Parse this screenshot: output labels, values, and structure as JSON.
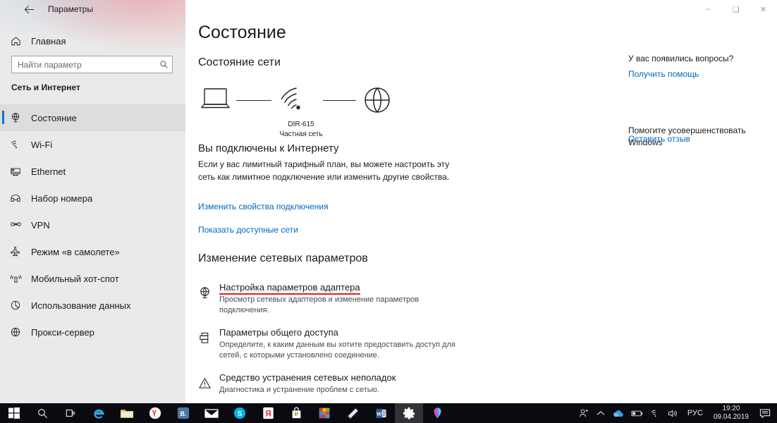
{
  "window": {
    "title": "Параметры",
    "back_icon": "back-arrow-icon",
    "minimize_label": "–",
    "maximize_label": "❑",
    "close_label": "✕"
  },
  "sidebar": {
    "home": {
      "label": "Главная",
      "icon": "home-icon"
    },
    "search": {
      "value": "",
      "placeholder": "Найти параметр",
      "icon": "search-icon"
    },
    "group_title": "Сеть и Интернет",
    "items": [
      {
        "label": "Состояние",
        "icon": "network-status-icon",
        "selected": true
      },
      {
        "label": "Wi-Fi",
        "icon": "wifi-icon",
        "selected": false
      },
      {
        "label": "Ethernet",
        "icon": "ethernet-icon",
        "selected": false
      },
      {
        "label": "Набор номера",
        "icon": "dialup-icon",
        "selected": false
      },
      {
        "label": "VPN",
        "icon": "vpn-icon",
        "selected": false
      },
      {
        "label": "Режим «в самолете»",
        "icon": "airplane-icon",
        "selected": false
      },
      {
        "label": "Мобильный хот-спот",
        "icon": "hotspot-icon",
        "selected": false
      },
      {
        "label": "Использование данных",
        "icon": "data-usage-icon",
        "selected": false
      },
      {
        "label": "Прокси-сервер",
        "icon": "proxy-globe-icon",
        "selected": false
      }
    ]
  },
  "main": {
    "page_title": "Состояние",
    "section_title": "Состояние сети",
    "diagram": {
      "pc_icon": "laptop-icon",
      "router_icon": "wifi-signal-icon",
      "internet_icon": "globe-icon",
      "ssid": "DIR-615",
      "network_type": "Частная сеть"
    },
    "connection": {
      "heading": "Вы подключены к Интернету",
      "description": "Если у вас лимитный тарифный план, вы можете настроить эту сеть как лимитное подключение или изменить другие свойства.",
      "link_properties": "Изменить свойства подключения",
      "link_available": "Показать доступные сети"
    },
    "change_settings_title": "Изменение сетевых параметров",
    "options": [
      {
        "title": "Настройка параметров адаптера",
        "desc": "Просмотр сетевых адаптеров и изменение параметров подключения.",
        "icon": "adapter-globe-icon",
        "underlined": true
      },
      {
        "title": "Параметры общего доступа",
        "desc": "Определите, к каким данным вы хотите предоставить доступ для сетей, с которыми установлено соединение.",
        "icon": "sharing-icon",
        "underlined": false
      },
      {
        "title": "Средство устранения сетевых неполадок",
        "desc": "Диагностика и устранение проблем с сетью.",
        "icon": "troubleshoot-warning-icon",
        "underlined": false
      }
    ]
  },
  "right_panel": {
    "questions_heading": "У вас появились вопросы?",
    "get_help_link": "Получить помощь",
    "improve_heading": "Помогите усовершенствовать Windows",
    "feedback_link": "Оставить отзыв"
  },
  "taskbar": {
    "buttons": [
      {
        "name": "start-button",
        "icon": "windows-logo-icon"
      },
      {
        "name": "search-button",
        "icon": "search-icon"
      },
      {
        "name": "task-view-button",
        "icon": "task-view-icon"
      },
      {
        "name": "edge-button",
        "icon": "edge-icon"
      },
      {
        "name": "file-explorer-button",
        "icon": "folder-icon"
      },
      {
        "name": "yandex-browser-button",
        "icon": "yandex-browser-icon"
      },
      {
        "name": "vkontakte-button",
        "icon": "vk-icon"
      },
      {
        "name": "mail-button",
        "icon": "mail-envelope-icon"
      },
      {
        "name": "skype-button",
        "icon": "skype-icon"
      },
      {
        "name": "yandex-button",
        "icon": "yandex-icon"
      },
      {
        "name": "store-button",
        "icon": "microsoft-store-icon"
      },
      {
        "name": "photos-button",
        "icon": "photos-icon"
      },
      {
        "name": "onenote-button",
        "icon": "onenote-icon"
      },
      {
        "name": "word-button",
        "icon": "word-icon"
      },
      {
        "name": "settings-button",
        "icon": "gear-icon"
      },
      {
        "name": "maps-button",
        "icon": "maps-pin-icon"
      }
    ],
    "tray": {
      "people_icon": "people-icon",
      "chevron_icon": "chevron-up-icon",
      "onedrive_icon": "onedrive-cloud-icon",
      "battery_icon": "battery-icon",
      "wifi_icon": "wifi-tray-icon",
      "volume_icon": "speaker-icon",
      "language": "РУС",
      "time": "19:20",
      "date": "09.04.2019",
      "action_center_icon": "action-center-icon"
    }
  },
  "colors": {
    "accent": "#0078d7",
    "link": "#0067c0",
    "underline_red": "#e02020",
    "sidebar_bg": "#eaeaea",
    "taskbar_bg": "#0a0a10"
  }
}
